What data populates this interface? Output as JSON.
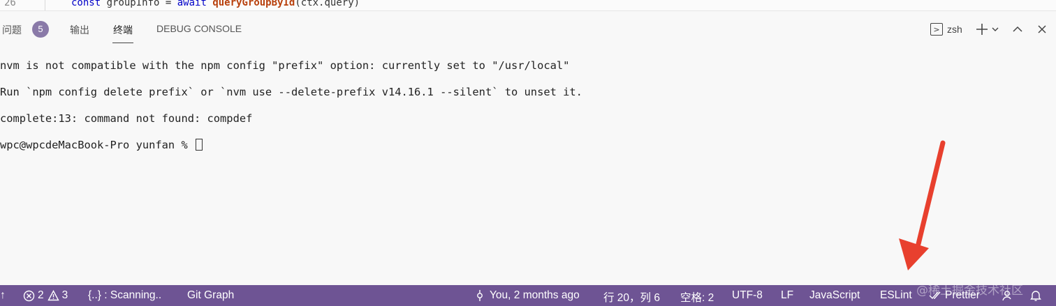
{
  "editor": {
    "line_number": "26",
    "code": {
      "kw1": "const",
      "var": " groupInfo ",
      "op": "= ",
      "kw2": "await",
      "sp": " ",
      "fn": "queryGroupById",
      "args": "(ctx.query)"
    }
  },
  "panel": {
    "tabs": [
      {
        "label": "问题"
      },
      {
        "label": "输出"
      },
      {
        "label": "终端"
      },
      {
        "label": "DEBUG CONSOLE"
      }
    ],
    "problems_count": "5",
    "active_tab": "终端",
    "shell": "zsh"
  },
  "terminal": {
    "lines": [
      "nvm is not compatible with the npm config \"prefix\" option: currently set to \"/usr/local\"",
      "Run `npm config delete prefix` or `nvm use --delete-prefix v14.16.1 --silent` to unset it.",
      "complete:13: command not found: compdef",
      "wpc@wpcdeMacBook-Pro yunfan % "
    ]
  },
  "statusbar": {
    "sync_icon": "↑",
    "errors": "2",
    "warnings": "3",
    "scanning": "{..} : Scanning..",
    "git_graph": "Git Graph",
    "blame": "You, 2 months ago",
    "position": "行 20，列 6",
    "spaces": "空格: 2",
    "encoding": "UTF-8",
    "eol": "LF",
    "language": "JavaScript",
    "eslint": "ESLint",
    "prettier": "Prettier",
    "background": "#6e5494"
  },
  "watermark": "@稀土掘金技术社区",
  "annotation": {
    "arrow_color": "#e8402e"
  }
}
